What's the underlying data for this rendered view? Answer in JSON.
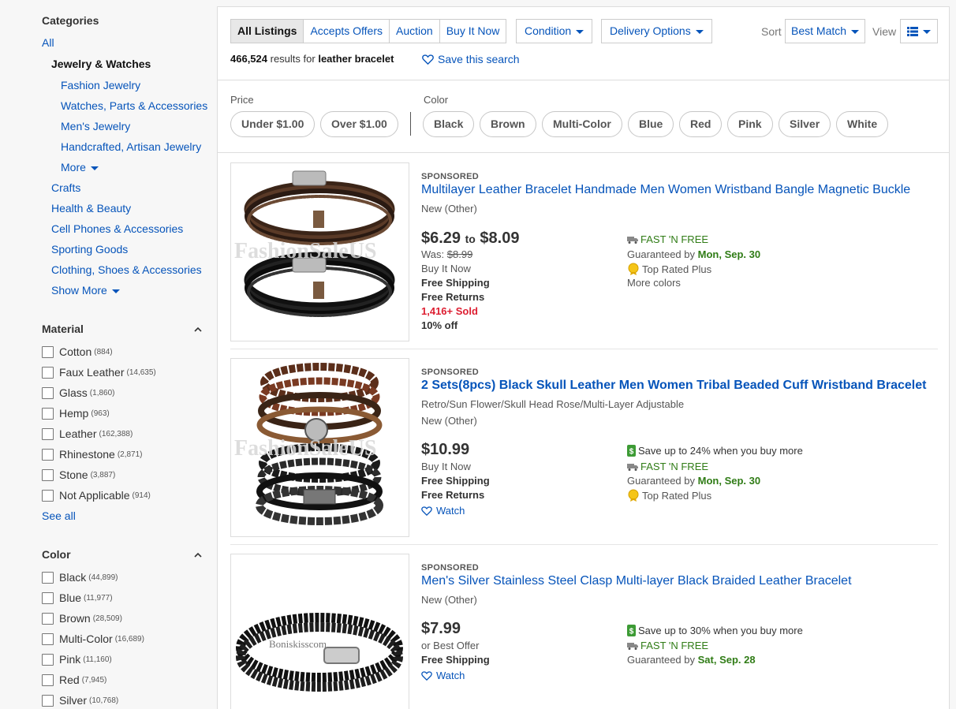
{
  "sidebar": {
    "categories_heading": "Categories",
    "all_link": "All",
    "current_category": "Jewelry & Watches",
    "subcategories": [
      "Fashion Jewelry",
      "Watches, Parts & Accessories",
      "Men's Jewelry",
      "Handcrafted, Artisan Jewelry"
    ],
    "more_label": "More",
    "other_categories": [
      "Crafts",
      "Health & Beauty",
      "Cell Phones & Accessories",
      "Sporting Goods",
      "Clothing, Shoes & Accessories"
    ],
    "show_more_label": "Show More",
    "material": {
      "heading": "Material",
      "options": [
        {
          "label": "Cotton",
          "count": "(884)"
        },
        {
          "label": "Faux Leather",
          "count": "(14,635)"
        },
        {
          "label": "Glass",
          "count": "(1,860)"
        },
        {
          "label": "Hemp",
          "count": "(963)"
        },
        {
          "label": "Leather",
          "count": "(162,388)"
        },
        {
          "label": "Rhinestone",
          "count": "(2,871)"
        },
        {
          "label": "Stone",
          "count": "(3,887)"
        },
        {
          "label": "Not Applicable",
          "count": "(914)"
        }
      ],
      "see_all": "See all"
    },
    "color": {
      "heading": "Color",
      "options": [
        {
          "label": "Black",
          "count": "(44,899)"
        },
        {
          "label": "Blue",
          "count": "(11,977)"
        },
        {
          "label": "Brown",
          "count": "(28,509)"
        },
        {
          "label": "Multi-Color",
          "count": "(16,689)"
        },
        {
          "label": "Pink",
          "count": "(11,160)"
        },
        {
          "label": "Red",
          "count": "(7,945)"
        },
        {
          "label": "Silver",
          "count": "(10,768)"
        }
      ]
    }
  },
  "toolbar": {
    "tabs": [
      "All Listings",
      "Accepts Offers",
      "Auction",
      "Buy It Now"
    ],
    "condition_label": "Condition",
    "delivery_label": "Delivery Options",
    "sort_label": "Sort",
    "sort_value": "Best Match",
    "view_label": "View",
    "results_count": "466,524",
    "results_text": "results for",
    "query": "leather bracelet",
    "save_search": "Save this search"
  },
  "filters": {
    "price_label": "Price",
    "price_options": [
      "Under $1.00",
      "Over $1.00"
    ],
    "color_label": "Color",
    "color_options": [
      "Black",
      "Brown",
      "Multi-Color",
      "Blue",
      "Red",
      "Pink",
      "Silver",
      "White"
    ]
  },
  "listings": [
    {
      "sponsored": "SPONSORED",
      "title": "Multilayer Leather Bracelet Handmade Men Women Wristband Bangle Magnetic Buckle",
      "condition": "New (Other)",
      "price_low": "$6.29",
      "price_to": "to",
      "price_high": "$8.09",
      "was_label": "Was:",
      "was_price": "$8.99",
      "format": "Buy It Now",
      "shipping": "Free Shipping",
      "returns": "Free Returns",
      "sold": "1,416+ Sold",
      "discount": "10% off",
      "fast": "FAST 'N FREE",
      "guaranteed_label": "Guaranteed by",
      "guaranteed_date": "Mon, Sep. 30",
      "top_rated": "Top Rated Plus",
      "more_colors": "More colors",
      "watermark": "FashionSaleUS"
    },
    {
      "sponsored": "SPONSORED",
      "title": "2 Sets(8pcs) Black Skull Leather Men Women Tribal Beaded Cuff Wristband Bracelet",
      "subtitle": "Retro/Sun Flower/Skull Head Rose/Multi-Layer Adjustable",
      "condition": "New (Other)",
      "price": "$10.99",
      "format": "Buy It Now",
      "shipping": "Free Shipping",
      "returns": "Free Returns",
      "watch": "Watch",
      "save_more": "Save up to 24% when you buy more",
      "fast": "FAST 'N FREE",
      "guaranteed_label": "Guaranteed by",
      "guaranteed_date": "Mon, Sep. 30",
      "top_rated": "Top Rated Plus",
      "watermark": "FashionSaleUS"
    },
    {
      "sponsored": "SPONSORED",
      "title": "Men's Silver Stainless Steel Clasp Multi-layer Black Braided Leather Bracelet",
      "condition": "New (Other)",
      "price": "$7.99",
      "format": "or Best Offer",
      "shipping": "Free Shipping",
      "watch": "Watch",
      "save_more": "Save up to 30% when you buy more",
      "fast": "FAST 'N FREE",
      "guaranteed_label": "Guaranteed by",
      "guaranteed_date": "Sat, Sep. 28",
      "watermark": "Boniskisscom"
    }
  ]
}
